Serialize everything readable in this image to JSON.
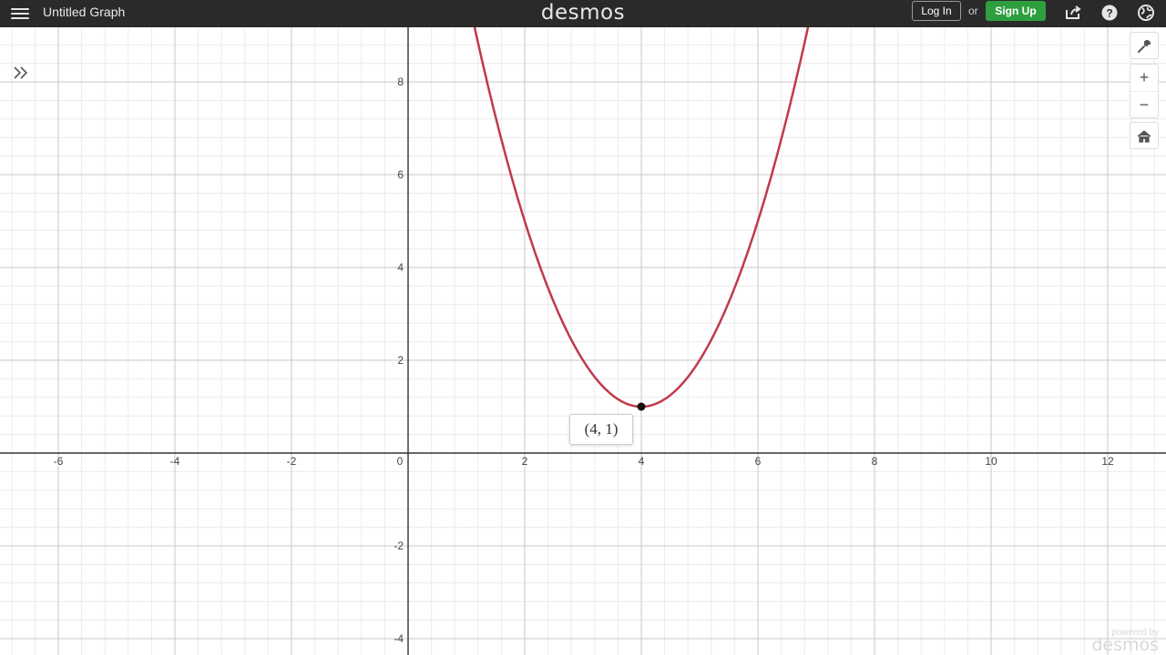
{
  "topbar": {
    "title": "Untitled Graph",
    "logo": "desmos",
    "login_label": "Log In",
    "or_label": "or",
    "signup_label": "Sign Up",
    "icons": [
      "share-icon",
      "help-icon",
      "language-icon"
    ]
  },
  "controls": {
    "zoom_in_label": "+",
    "zoom_out_label": "−",
    "icons": [
      "wrench-icon",
      "home-icon",
      "expand-list-icon"
    ]
  },
  "point_label": "(4, 1)",
  "footer": {
    "powered_by": "powered by",
    "logo": "desmos"
  },
  "colors": {
    "curve": "#c0394b",
    "signup": "#2f9e3f",
    "topbar": "#2a2a2a"
  },
  "chart_data": {
    "type": "line",
    "function": "(x-4)^2+1",
    "vertex": [
      4,
      1
    ],
    "x_ticks": [
      "-6",
      "-4",
      "-2",
      "0",
      "2",
      "4",
      "6",
      "8",
      "10",
      "12"
    ],
    "y_ticks": [
      "8",
      "6",
      "4",
      "2",
      "-2",
      "-4"
    ],
    "xlim": [
      -7,
      13
    ],
    "ylim": [
      -4.2,
      9.2
    ],
    "grid": true
  }
}
